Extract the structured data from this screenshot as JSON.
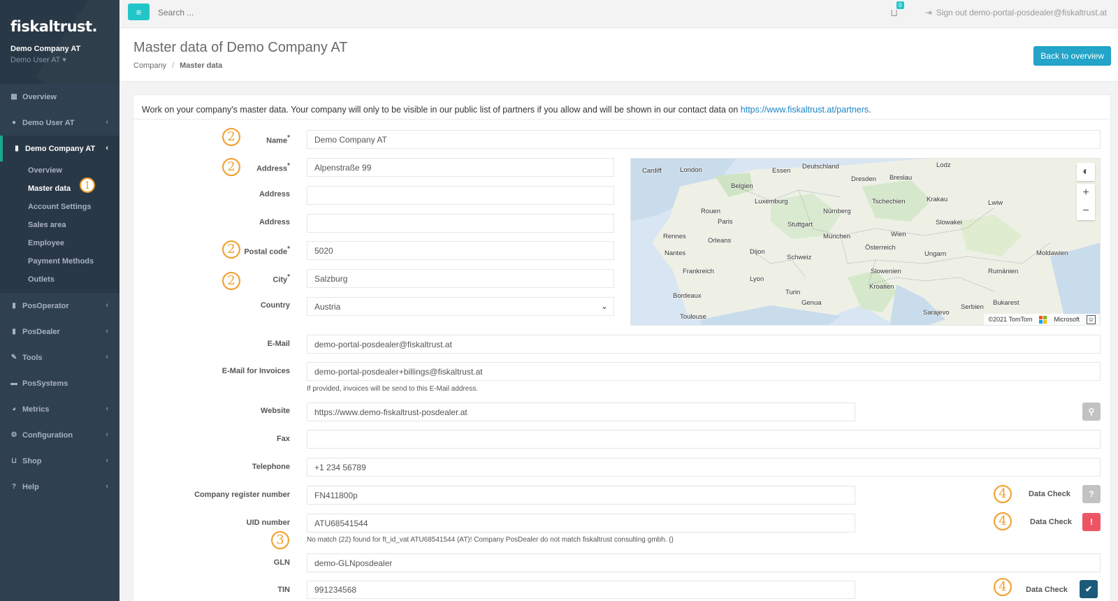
{
  "sidebar": {
    "logo": "fiskaltrust.",
    "company": "Demo Company AT",
    "user": "Demo User AT",
    "items": [
      {
        "label": "Overview",
        "icon": "th-large-icon"
      },
      {
        "label": "Demo User AT",
        "icon": "user-icon"
      },
      {
        "label": "Demo Company AT",
        "icon": "building-icon"
      },
      {
        "label": "PosOperator",
        "icon": "building-icon"
      },
      {
        "label": "PosDealer",
        "icon": "building-icon"
      },
      {
        "label": "Tools",
        "icon": "wrench-icon"
      },
      {
        "label": "PosSystems",
        "icon": "briefcase-icon"
      },
      {
        "label": "Metrics",
        "icon": "pie-chart-icon"
      },
      {
        "label": "Configuration",
        "icon": "cogs-icon"
      },
      {
        "label": "Shop",
        "icon": "basket-icon"
      },
      {
        "label": "Help",
        "icon": "question-circle-icon"
      }
    ],
    "subitems": [
      "Overview",
      "Master data",
      "Account Settings",
      "Sales area",
      "Employee",
      "Payment Methods",
      "Outlets"
    ]
  },
  "topbar": {
    "search_placeholder": "Search ...",
    "cart_count": "0",
    "signout": "Sign out demo-portal-posdealer@fiskaltrust.at"
  },
  "heading": {
    "title": "Master data of Demo Company AT",
    "breadcrumb": [
      "Company",
      "Master data"
    ],
    "back_button": "Back to overview"
  },
  "intro": {
    "text": "Work on your company's master data. Your company will only to be visible in our public list of partners if you allow and will be shown in our contact data on ",
    "link": "https://www.fiskaltrust.at/partners",
    "end": "."
  },
  "form": {
    "name": {
      "label": "Name",
      "value": "Demo Company AT"
    },
    "address1": {
      "label": "Address",
      "value": "Alpenstraße 99"
    },
    "address2": {
      "label": "Address",
      "value": ""
    },
    "address3": {
      "label": "Address",
      "value": ""
    },
    "postal": {
      "label": "Postal code",
      "value": "5020"
    },
    "city": {
      "label": "City",
      "value": "Salzburg"
    },
    "country": {
      "label": "Country",
      "value": "Austria"
    },
    "email": {
      "label": "E-Mail",
      "value": "demo-portal-posdealer@fiskaltrust.at"
    },
    "email_invoices": {
      "label": "E-Mail for Invoices",
      "value": "demo-portal-posdealer+billings@fiskaltrust.at",
      "help": "If provided, invoices will be send to this E-Mail address."
    },
    "website": {
      "label": "Website",
      "value": "https://www.demo-fiskaltrust-posdealer.at"
    },
    "fax": {
      "label": "Fax",
      "value": ""
    },
    "telephone": {
      "label": "Telephone",
      "value": "+1 234 56789"
    },
    "register": {
      "label": "Company register number",
      "value": "FN411800p"
    },
    "uid": {
      "label": "UID number",
      "value": "ATU68541544",
      "help": "No match (22) found for ft_id_vat ATU68541544 (AT)! Company PosDealer do not match fiskaltrust consulting gmbh. ()"
    },
    "gln": {
      "label": "GLN",
      "value": "demo-GLNposdealer"
    },
    "tin": {
      "label": "TIN",
      "value": "991234568"
    },
    "required_mark": "*",
    "data_check": "Data Check"
  },
  "markers": {
    "m1": "1",
    "m2": "2",
    "m3": "3",
    "m4": "4"
  },
  "map": {
    "attribution_tomtom": "©2021 TomTom",
    "attribution_ms": "Microsoft",
    "labels": [
      "Cardiff",
      "London",
      "Essen",
      "Deutschland",
      "Lodz",
      "Dresden",
      "Breslau",
      "Belgien",
      "Luxemburg",
      "Tschechien",
      "Krakau",
      "Lwiw",
      "Rouen",
      "Paris",
      "Nürnberg",
      "Stuttgart",
      "Slowakei",
      "Rennes",
      "Orleans",
      "Dijon",
      "München",
      "Wien",
      "Nantes",
      "Schweiz",
      "Österreich",
      "Ungarn",
      "Moldawien",
      "Frankreich",
      "Lyon",
      "Slowenien",
      "Rumänien",
      "Bordeaux",
      "Turin",
      "Genua",
      "Kroatien",
      "Bukarest",
      "Toulouse",
      "Sarajevo",
      "Serbien"
    ]
  },
  "colors": {
    "accent": "#23c6c8",
    "sidebar": "#2f4050",
    "danger": "#ed5565",
    "primary_dark": "#1c5a7a",
    "neutral": "#c2c2c2",
    "marker": "#f0a030"
  }
}
